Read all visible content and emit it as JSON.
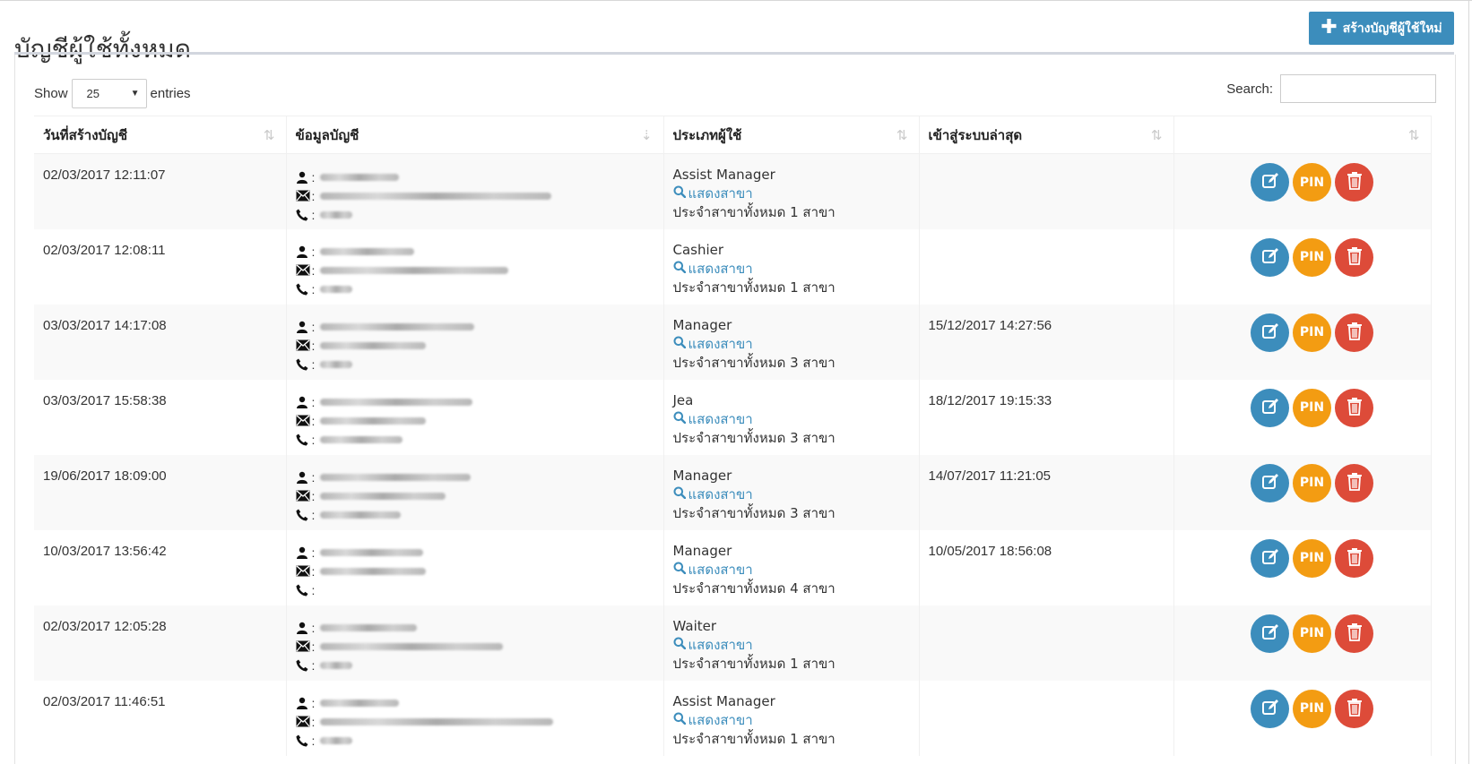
{
  "page": {
    "title": "บัญชีผู้ใช้ทั้งหมด"
  },
  "toolbar": {
    "create_label": "สร้างบัญชีผู้ใช้ใหม่"
  },
  "table_controls": {
    "show_label": "Show",
    "entries_value": "25",
    "entries_label": "entries",
    "search_label": "Search:",
    "search_value": ""
  },
  "columns": [
    "วันที่สร้างบัญชี",
    "ข้อมูลบัญชี",
    "ประเภทผู้ใช้",
    "เข้าสู่ระบบล่าสุด",
    ""
  ],
  "branch_link_label": "แสดงสาขา",
  "pin_label": "PIN",
  "icons": {
    "sort": "sort-arrows-icon",
    "user": "user-icon",
    "email": "envelope-icon",
    "phone": "phone-icon",
    "search": "search-icon",
    "edit": "edit-icon",
    "delete": "trash-icon"
  },
  "colors": {
    "primary": "#3c8dbc",
    "pin": "#f39c12",
    "danger": "#dd4b39"
  },
  "rows": [
    {
      "created": "02/03/2017 12:11:07",
      "type": "Assist Manager",
      "branches": "ประจำสาขาทั้งหมด 1 สาขา",
      "last_login": ""
    },
    {
      "created": "02/03/2017 12:08:11",
      "type": "Cashier",
      "branches": "ประจำสาขาทั้งหมด 1 สาขา",
      "last_login": ""
    },
    {
      "created": "03/03/2017 14:17:08",
      "type": "Manager",
      "branches": "ประจำสาขาทั้งหมด 3 สาขา",
      "last_login": "15/12/2017 14:27:56"
    },
    {
      "created": "03/03/2017 15:58:38",
      "type": "Jea",
      "branches": "ประจำสาขาทั้งหมด 3 สาขา",
      "last_login": "18/12/2017 19:15:33"
    },
    {
      "created": "19/06/2017 18:09:00",
      "type": "Manager",
      "branches": "ประจำสาขาทั้งหมด 3 สาขา",
      "last_login": "14/07/2017 11:21:05"
    },
    {
      "created": "10/03/2017 13:56:42",
      "type": "Manager",
      "branches": "ประจำสาขาทั้งหมด 4 สาขา",
      "last_login": "10/05/2017 18:56:08"
    },
    {
      "created": "02/03/2017 12:05:28",
      "type": "Waiter",
      "branches": "ประจำสาขาทั้งหมด 1 สาขา",
      "last_login": ""
    },
    {
      "created": "02/03/2017 11:46:51",
      "type": "Assist Manager",
      "branches": "ประจำสาขาทั้งหมด 1 สาขา",
      "last_login": ""
    }
  ]
}
